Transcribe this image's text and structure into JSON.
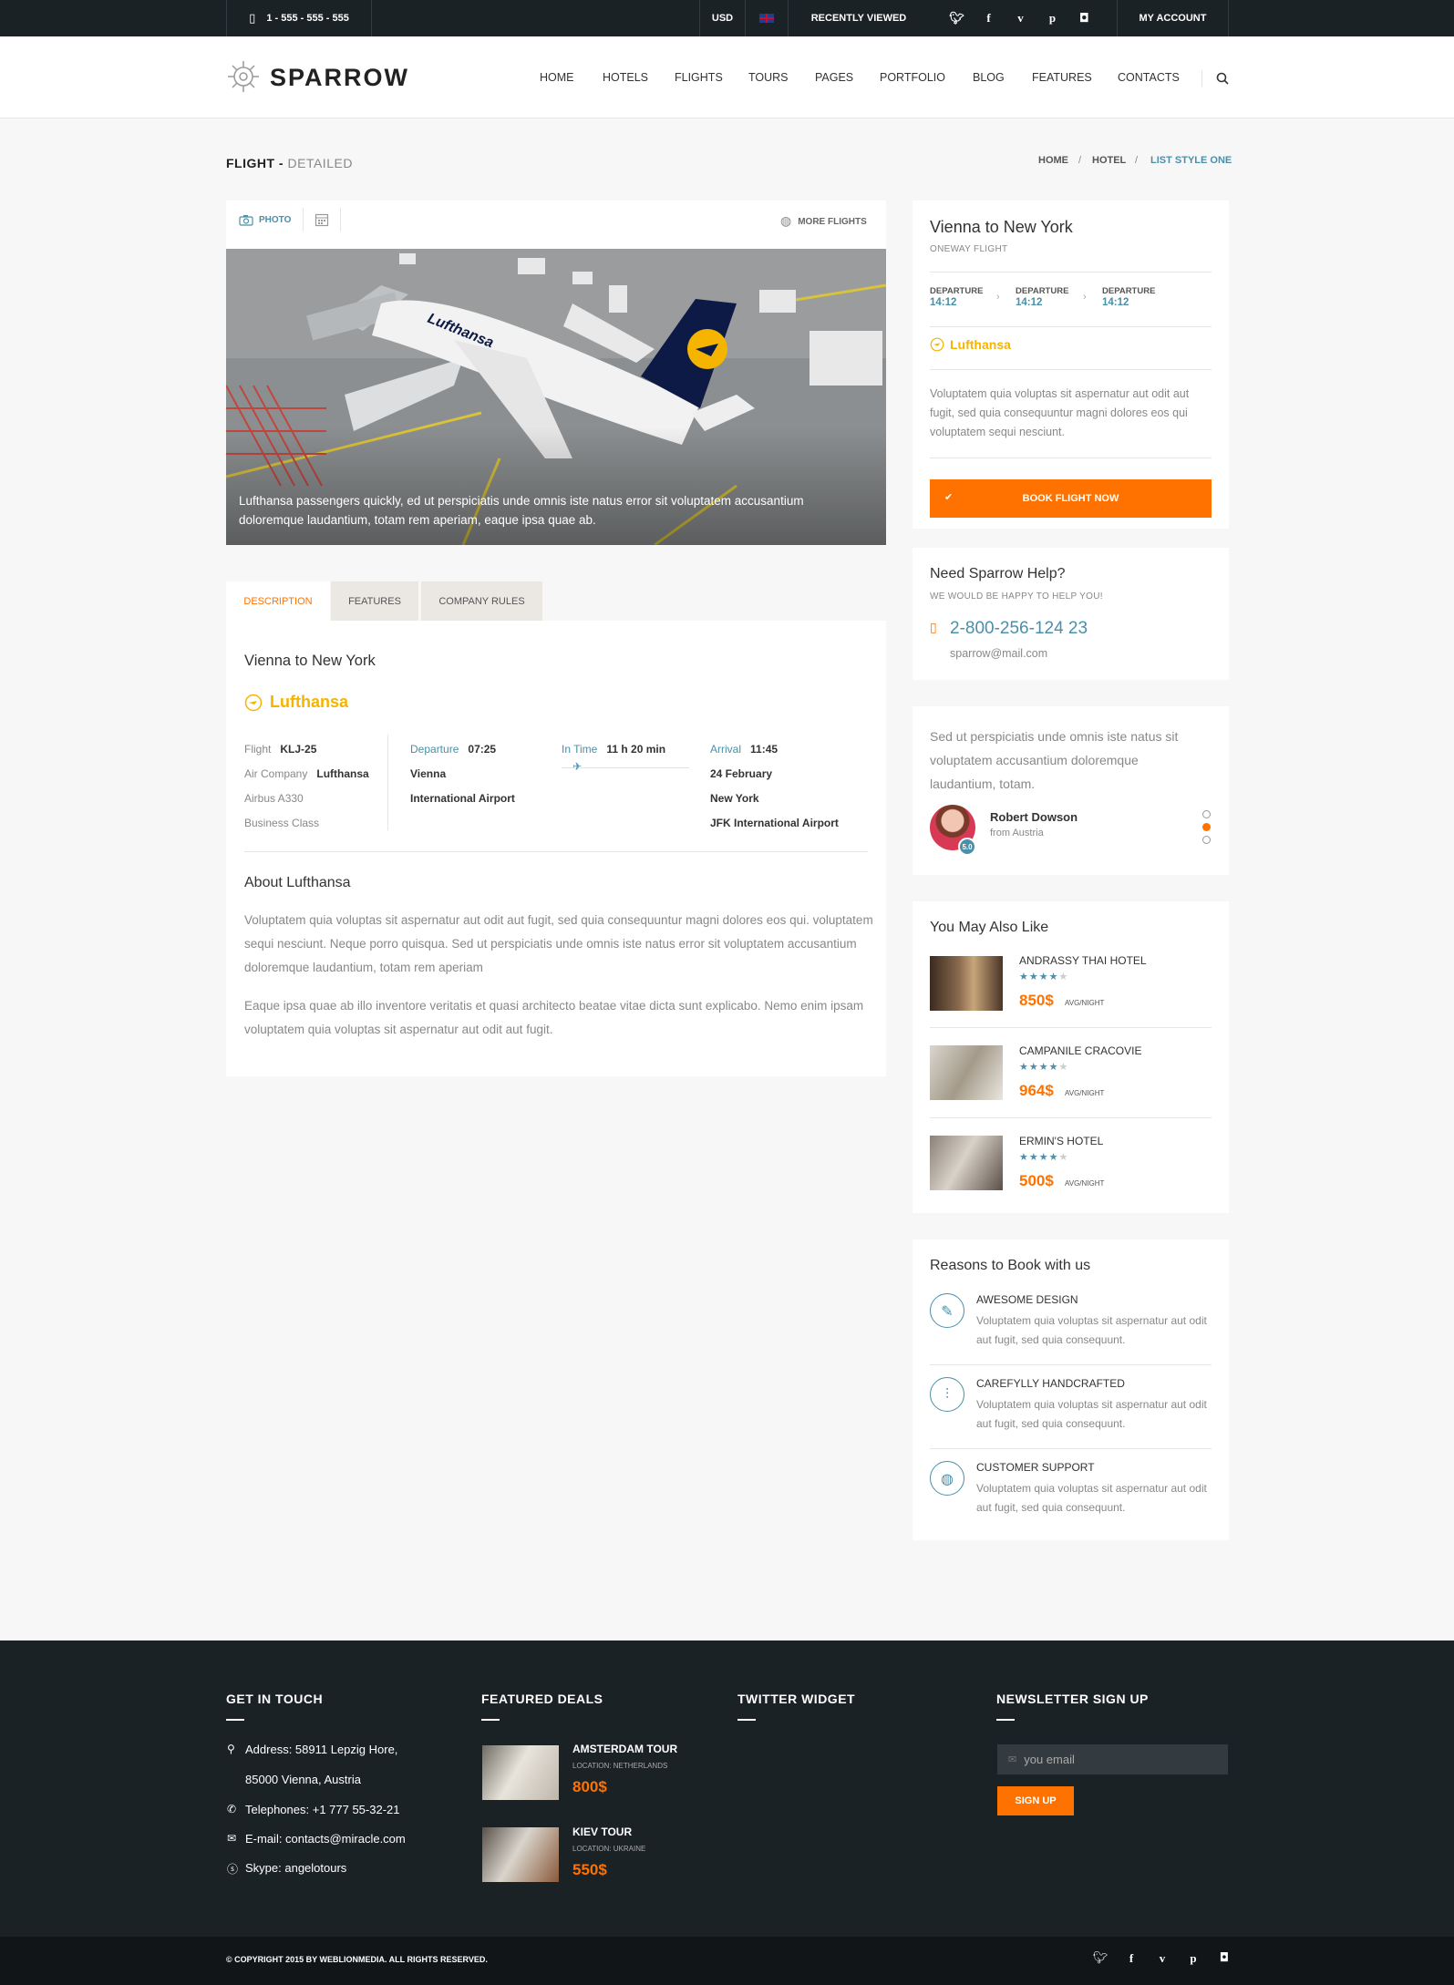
{
  "topbar": {
    "phone": "1 - 555 - 555 - 555",
    "currency": "USD",
    "recently_viewed": "RECENTLY VIEWED",
    "my_account": "MY ACCOUNT",
    "social_icons": [
      "twitter-icon",
      "facebook-icon",
      "vimeo-icon",
      "pinterest-icon",
      "instagram-icon"
    ]
  },
  "header": {
    "logo": "SPARROW",
    "nav": [
      "HOME",
      "HOTELS",
      "FLIGHTS",
      "TOURS",
      "PAGES",
      "PORTFOLIO",
      "BLOG",
      "FEATURES",
      "CONTACTS"
    ]
  },
  "title": {
    "main": "FLIGHT - ",
    "sub": "DETAILED",
    "breadcrumbs": [
      "HOME",
      "HOTEL",
      "LIST STYLE ONE"
    ]
  },
  "gallery": {
    "photo_tab": "PHOTO",
    "more_flights": "MORE FLIGHTS",
    "caption": "Lufthansa passengers quickly, ed ut perspiciatis unde omnis iste natus error sit voluptatem accusantium doloremque laudantium, totam rem aperiam, eaque ipsa quae ab."
  },
  "tabs": [
    "DESCRIPTION",
    "FEATURES",
    "COMPANY RULES"
  ],
  "description": {
    "route": "Vienna to New York",
    "airline": "Lufthansa",
    "flight_label": "Flight",
    "flight_value": "KLJ-25",
    "company_label": "Air Company",
    "company_value": "Lufthansa",
    "aircraft": "Airbus A330",
    "class": "Business Class",
    "departure_label": "Departure",
    "departure_time": "07:25",
    "departure_city": "Vienna",
    "departure_airport": "International Airport",
    "intime_label": "In Time",
    "intime_value": "11 h 20 min",
    "arrival_label": "Arrival",
    "arrival_time": "11:45",
    "arrival_date": "24 February",
    "arrival_city": "New York",
    "arrival_airport": "JFK International Airport",
    "about_title": "About Lufthansa",
    "about_p1": "Voluptatem quia voluptas sit aspernatur aut odit aut fugit, sed quia consequuntur magni dolores eos qui. voluptatem sequi nesciunt. Neque porro quisqua. Sed ut perspiciatis unde omnis iste natus error sit voluptatem accusantium doloremque laudantium, totam rem aperiam",
    "about_p2": "Eaque ipsa quae ab illo inventore veritatis et quasi architecto beatae vitae dicta sunt explicabo. Nemo enim ipsam voluptatem quia voluptas sit aspernatur aut odit aut fugit."
  },
  "booking": {
    "route": "Vienna to New York",
    "type": "ONEWAY FLIGHT",
    "departure_label": "DEPARTURE",
    "departure_time": "14:12",
    "airline": "Lufthansa",
    "text": "Voluptatem quia voluptas sit aspernatur aut odit aut fugit, sed quia consequuntur magni dolores eos qui voluptatem sequi nesciunt.",
    "book_button": "BOOK FLIGHT NOW"
  },
  "help": {
    "title": "Need Sparrow Help?",
    "subtitle": "WE WOULD BE HAPPY TO HELP YOU!",
    "phone": "2-800-256-124 23",
    "email": "sparrow@mail.com"
  },
  "testimonial": {
    "text": "Sed ut perspiciatis unde omnis iste natus sit voluptatem accusantium doloremque laudantium, totam.",
    "name": "Robert Dowson",
    "from": "from Austria",
    "rating": "5.0"
  },
  "also_like": {
    "title": "You May Also Like",
    "unit": "AVG/NIGHT",
    "items": [
      {
        "name": "ANDRASSY THAI HOTEL",
        "price": "850$",
        "stars": 4
      },
      {
        "name": "CAMPANILE CRACOVIE",
        "price": "964$",
        "stars": 4
      },
      {
        "name": "ERMIN'S HOTEL",
        "price": "500$",
        "stars": 4
      }
    ]
  },
  "reasons": {
    "title": "Reasons to Book with us",
    "items": [
      {
        "title": "AWESOME DESIGN",
        "text": "Voluptatem quia voluptas sit aspernatur aut odit aut fugit, sed quia consequunt.",
        "icon": "pencil-icon"
      },
      {
        "title": "CAREFYLLY HANDCRAFTED",
        "text": "Voluptatem quia voluptas sit aspernatur aut odit aut fugit, sed quia consequunt.",
        "icon": "sliders-icon"
      },
      {
        "title": "CUSTOMER SUPPORT",
        "text": "Voluptatem quia voluptas sit aspernatur aut odit aut fugit, sed quia consequunt.",
        "icon": "globe-icon"
      }
    ]
  },
  "footer": {
    "get_in_touch": "GET IN TOUCH",
    "address1": "Address: 58911 Lepzig Hore,",
    "address2": "85000 Vienna, Austria",
    "telephone": "Telephones: +1 777 55-32-21",
    "email": "E-mail: contacts@miracle.com",
    "skype": "Skype: angelotours",
    "featured": "FEATURED DEALS",
    "deals": [
      {
        "name": "AMSTERDAM TOUR",
        "location": "LOCATION: NETHERLANDS",
        "price": "800$"
      },
      {
        "name": "KIEV TOUR",
        "location": "LOCATION: UKRAINE",
        "price": "550$"
      }
    ],
    "twitter": "TWITTER WIDGET",
    "newsletter": "NEWSLETTER SIGN UP",
    "email_placeholder": "you email",
    "signup": "SIGN UP",
    "copyright": "© COPYRIGHT 2015 BY WEBLIONMEDIA. ALL RIGHTS RESERVED."
  },
  "colors": {
    "accent": "#ff7200",
    "blue": "#4b8fa8",
    "dark": "#1b2226",
    "gold": "#f5b400"
  }
}
